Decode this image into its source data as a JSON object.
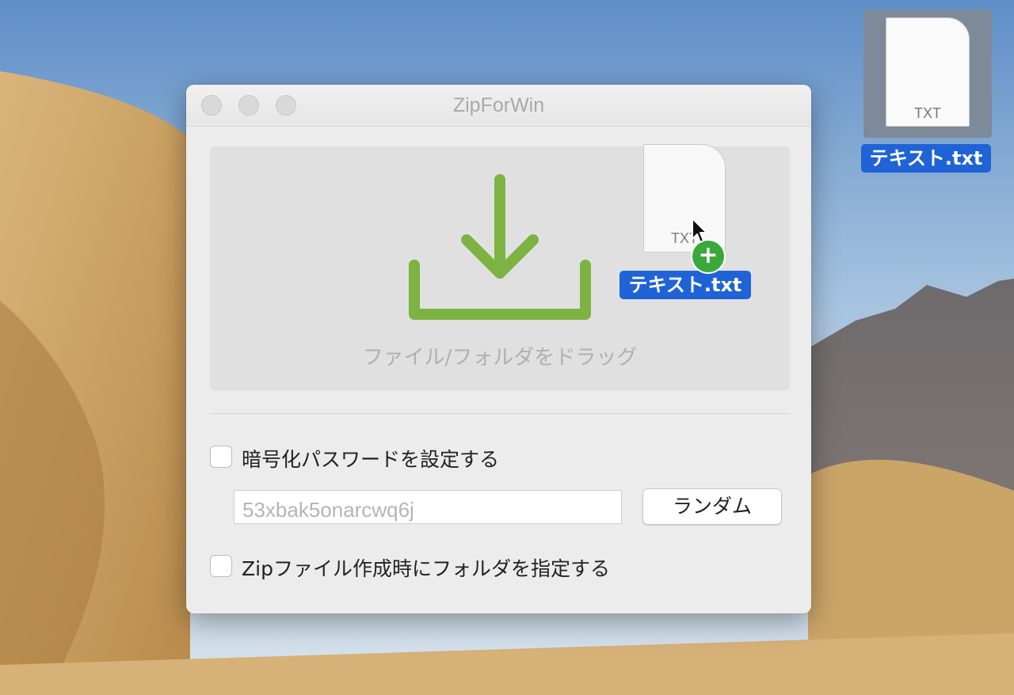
{
  "desktop": {
    "file_icon": {
      "ext": "TXT",
      "name": "テキスト.txt",
      "icon": "text-file-icon"
    }
  },
  "window": {
    "title": "ZipForWin",
    "drop_zone": {
      "hint": "ファイル/フォルダをドラッグ",
      "icon": "download-tray-icon",
      "accent": "#7cb342"
    },
    "dragged_file": {
      "ext": "TXT",
      "name": "テキスト.txt",
      "badge": "+"
    },
    "password_checkbox_label": "暗号化パスワードを設定する",
    "password_value": "53xbak5onarcwq6j",
    "random_button": "ランダム",
    "folder_checkbox_label": "Zipファイル作成時にフォルダを指定する"
  },
  "colors": {
    "selection_blue": "#1f63d6",
    "copy_badge_green": "#3aa83a"
  }
}
